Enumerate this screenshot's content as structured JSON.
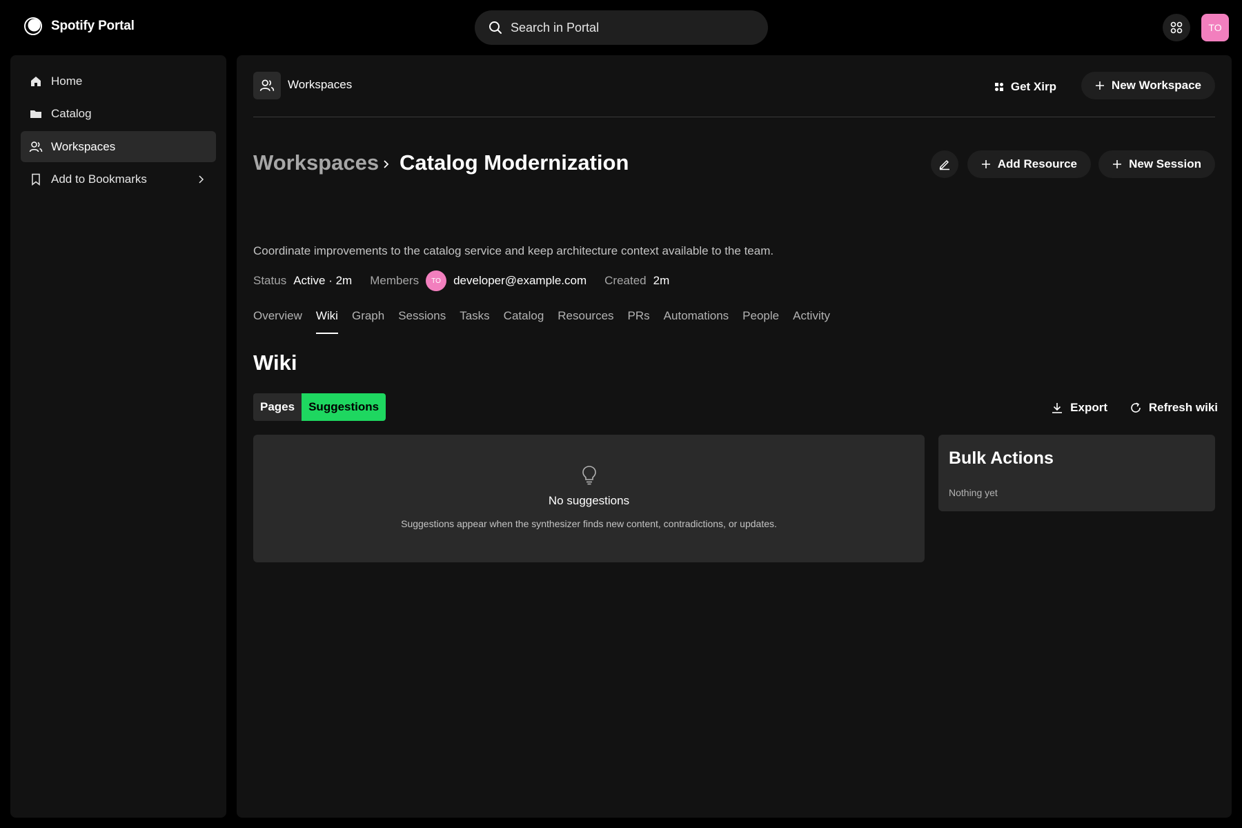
{
  "app": {
    "name": "Spotify Portal"
  },
  "search": {
    "placeholder": "Search in Portal"
  },
  "user": {
    "initials": "TO",
    "avatar_color": "#f27fbe"
  },
  "sidebar": {
    "items": [
      {
        "label": "Home",
        "icon": "home-icon"
      },
      {
        "label": "Catalog",
        "icon": "folder-icon"
      },
      {
        "label": "Workspaces",
        "icon": "users-icon",
        "active": true
      },
      {
        "label": "Add to Bookmarks",
        "icon": "bookmark-icon"
      }
    ]
  },
  "header": {
    "title": "Workspaces",
    "get_xirp": "Get Xirp",
    "new_workspace": "New Workspace"
  },
  "breadcrumb": {
    "parent": "Workspaces",
    "current": "Catalog Modernization"
  },
  "actions": {
    "add_resource": "Add Resource",
    "new_session": "New Session"
  },
  "workspace": {
    "description": "Coordinate improvements to the catalog service and keep architecture context available to the team.",
    "status_label": "Status",
    "status_value": "Active · 2m",
    "members_label": "Members",
    "member_initials": "TO",
    "member_email": "developer@example.com",
    "created_label": "Created",
    "created_value": "2m"
  },
  "tabs": [
    "Overview",
    "Wiki",
    "Graph",
    "Sessions",
    "Tasks",
    "Catalog",
    "Resources",
    "PRs",
    "Automations",
    "People",
    "Activity"
  ],
  "active_tab": "Wiki",
  "wiki": {
    "title": "Wiki",
    "segments": [
      "Pages",
      "Suggestions"
    ],
    "active_segment": "Suggestions",
    "export": "Export",
    "refresh": "Refresh wiki",
    "empty_title": "No suggestions",
    "empty_subtitle": "Suggestions appear when the synthesizer finds new content, contradictions, or updates.",
    "bulk_title": "Bulk Actions",
    "bulk_subtitle": "Nothing yet"
  },
  "colors": {
    "accent": "#1ed760",
    "background": "#000000",
    "panel": "#121212",
    "card": "#2a2a2a"
  }
}
